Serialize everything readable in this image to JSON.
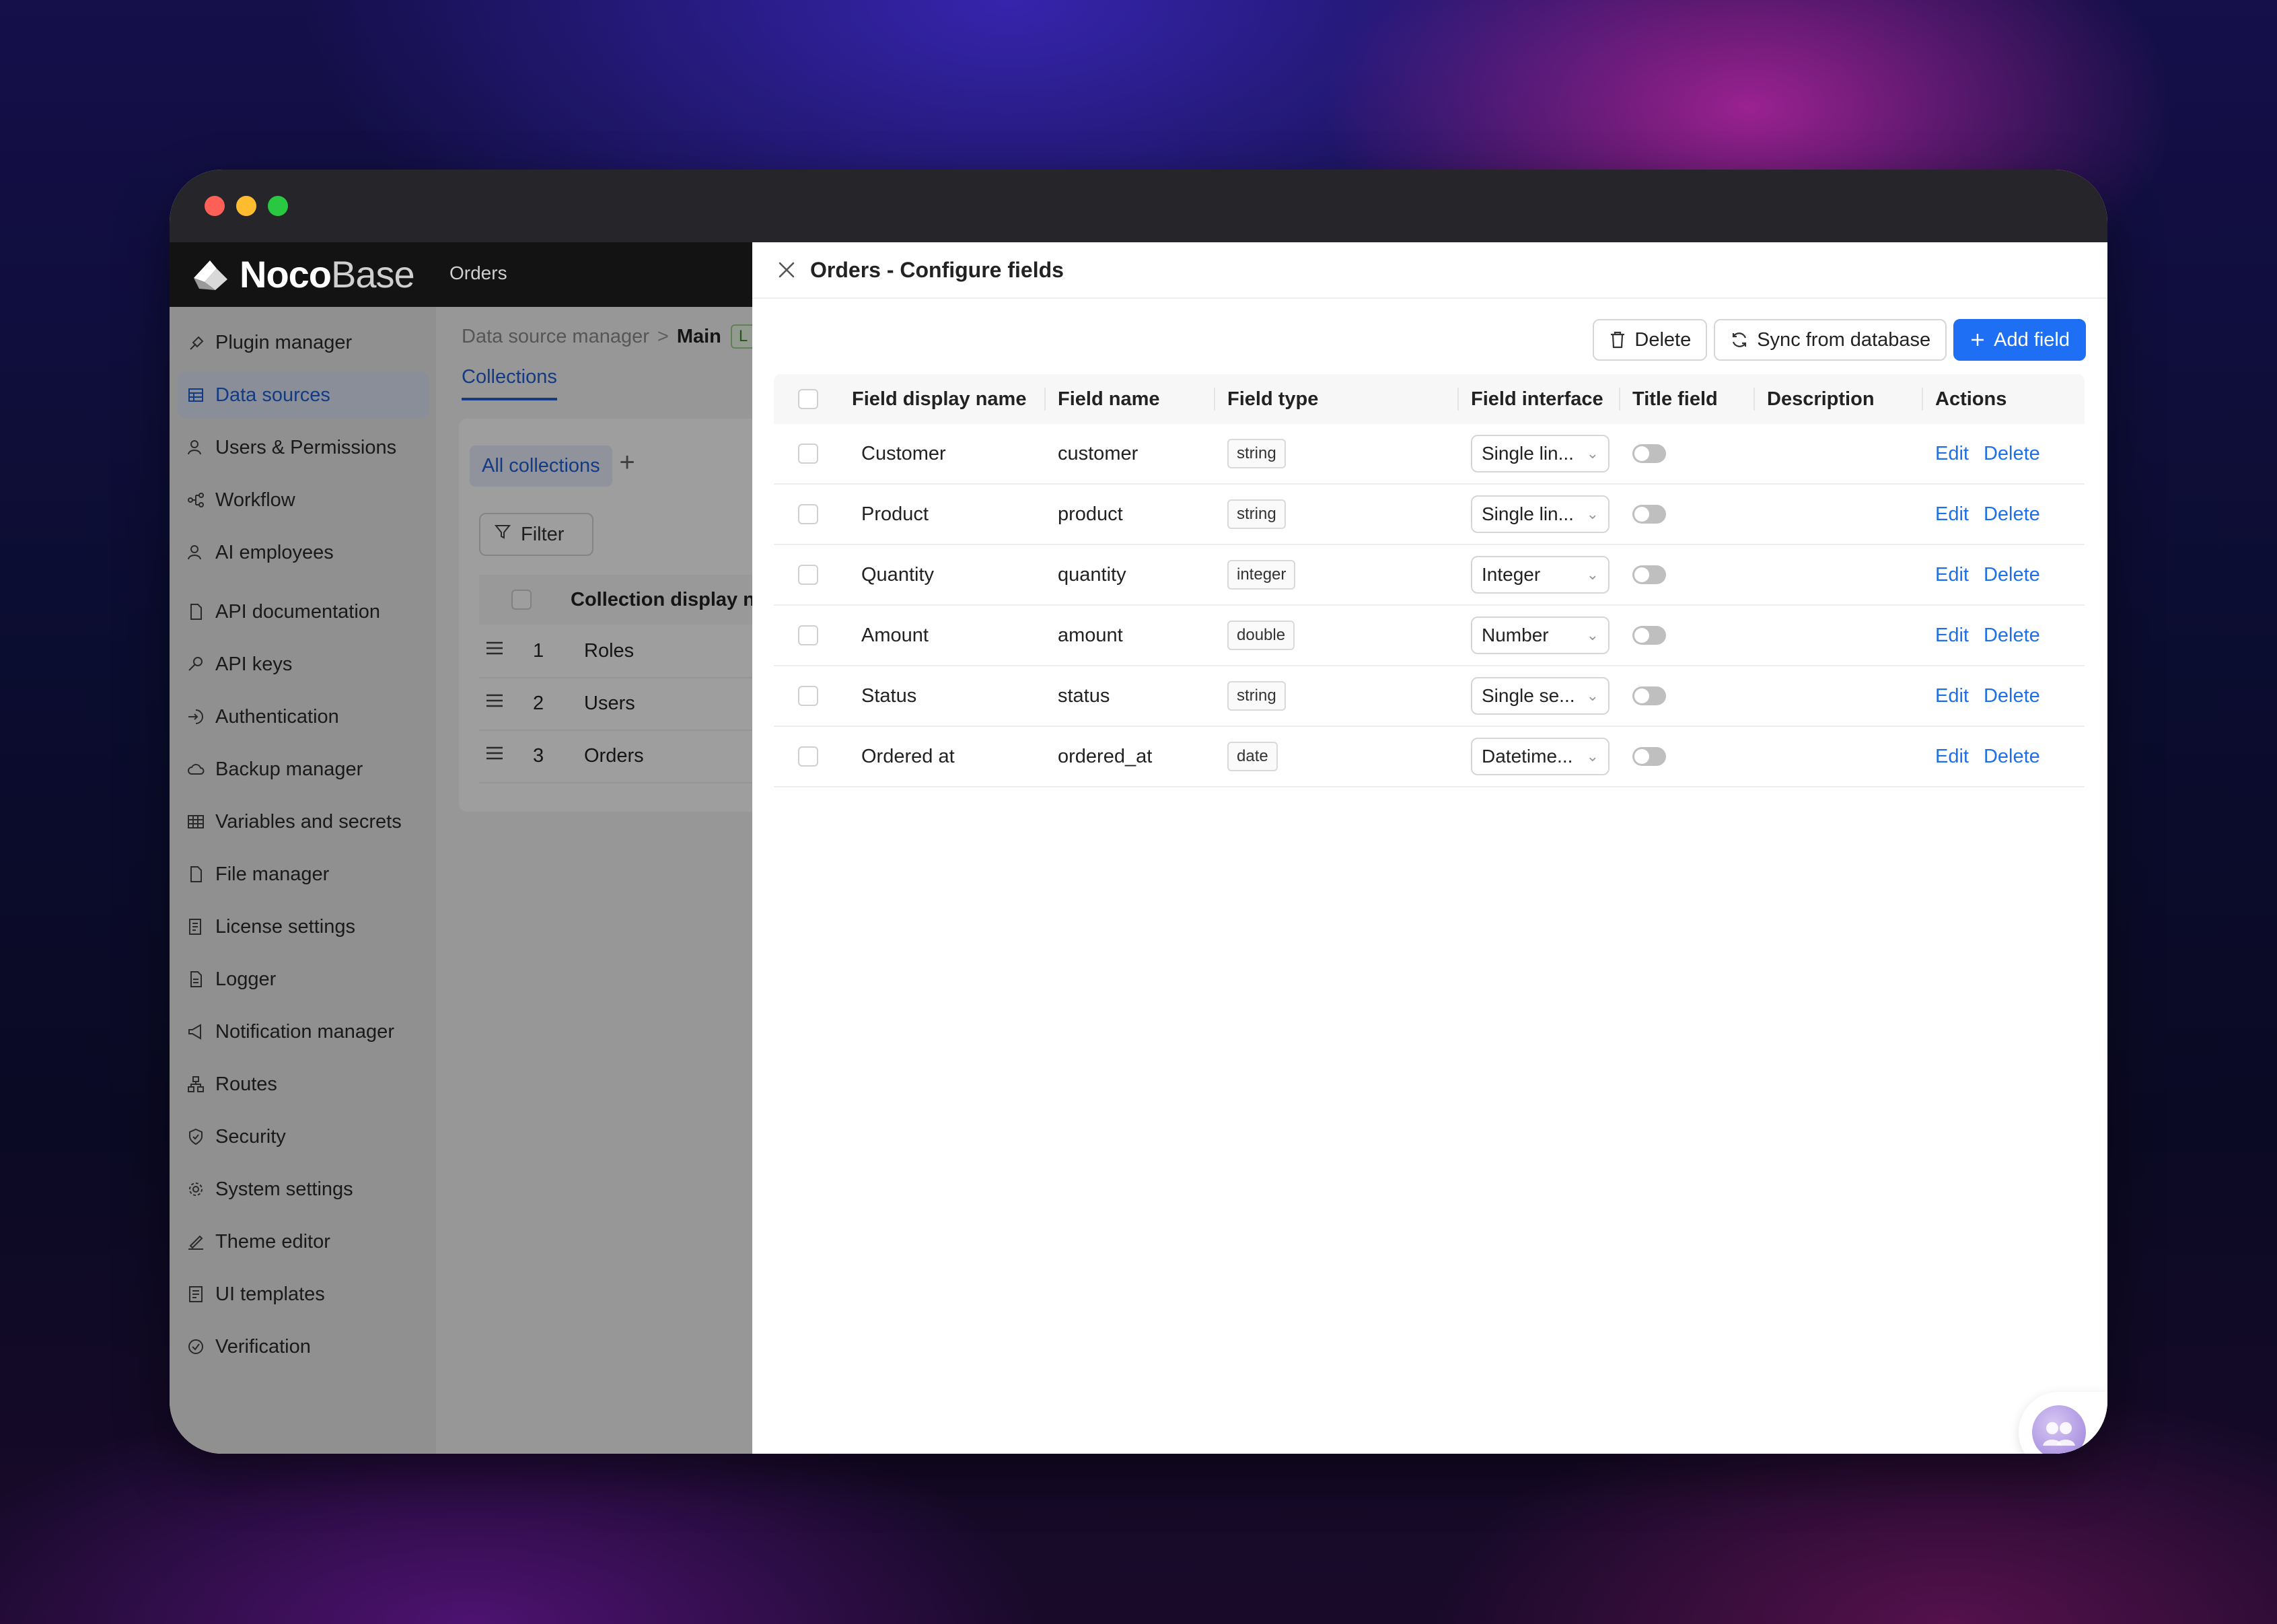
{
  "app": {
    "logo_bold": "Noco",
    "logo_light": "Base",
    "top_menu_item": "Orders"
  },
  "sidebar": {
    "items": [
      {
        "label": "Plugin manager",
        "icon": "plug-icon"
      },
      {
        "label": "Data sources",
        "icon": "database-icon",
        "active": true
      },
      {
        "label": "Users & Permissions",
        "icon": "users-icon"
      },
      {
        "label": "Workflow",
        "icon": "workflow-icon"
      },
      {
        "label": "AI employees",
        "icon": "ai-employee-icon"
      },
      {
        "label": "API documentation",
        "icon": "document-icon"
      },
      {
        "label": "API keys",
        "icon": "key-icon"
      },
      {
        "label": "Authentication",
        "icon": "login-icon"
      },
      {
        "label": "Backup manager",
        "icon": "cloud-icon"
      },
      {
        "label": "Variables and secrets",
        "icon": "table-icon"
      },
      {
        "label": "File manager",
        "icon": "file-icon"
      },
      {
        "label": "License settings",
        "icon": "license-icon"
      },
      {
        "label": "Logger",
        "icon": "log-icon"
      },
      {
        "label": "Notification manager",
        "icon": "megaphone-icon"
      },
      {
        "label": "Routes",
        "icon": "routes-icon"
      },
      {
        "label": "Security",
        "icon": "shield-icon"
      },
      {
        "label": "System settings",
        "icon": "gear-icon"
      },
      {
        "label": "Theme editor",
        "icon": "brush-icon"
      },
      {
        "label": "UI templates",
        "icon": "template-icon"
      },
      {
        "label": "Verification",
        "icon": "check-circle-icon"
      }
    ]
  },
  "background_page": {
    "breadcrumb": {
      "root": "Data source manager",
      "current": "Main",
      "tag": "L"
    },
    "tab": "Collections",
    "sub_tab": "All collections",
    "add_tab": "+",
    "filter_label": "Filter",
    "column_header": "Collection display n",
    "rows": [
      {
        "num": "1",
        "name": "Roles"
      },
      {
        "num": "2",
        "name": "Users"
      },
      {
        "num": "3",
        "name": "Orders"
      }
    ]
  },
  "drawer": {
    "title": "Orders - Configure fields",
    "buttons": {
      "delete": "Delete",
      "sync": "Sync from database",
      "add": "Add field"
    },
    "columns": [
      "Field display name",
      "Field name",
      "Field type",
      "Field interface",
      "Title field",
      "Description",
      "Actions"
    ],
    "rows": [
      {
        "display": "Customer",
        "name": "customer",
        "type": "string",
        "interface": "Single lin...",
        "title_field": false,
        "edit": "Edit",
        "delete": "Delete"
      },
      {
        "display": "Product",
        "name": "product",
        "type": "string",
        "interface": "Single lin...",
        "title_field": false,
        "edit": "Edit",
        "delete": "Delete"
      },
      {
        "display": "Quantity",
        "name": "quantity",
        "type": "integer",
        "interface": "Integer",
        "title_field": false,
        "edit": "Edit",
        "delete": "Delete"
      },
      {
        "display": "Amount",
        "name": "amount",
        "type": "double",
        "interface": "Number",
        "title_field": false,
        "edit": "Edit",
        "delete": "Delete"
      },
      {
        "display": "Status",
        "name": "status",
        "type": "string",
        "interface": "Single se...",
        "title_field": false,
        "edit": "Edit",
        "delete": "Delete"
      },
      {
        "display": "Ordered at",
        "name": "ordered_at",
        "type": "date",
        "interface": "Datetime...",
        "title_field": false,
        "edit": "Edit",
        "delete": "Delete"
      }
    ]
  },
  "colors": {
    "primary": "#1e6ff3",
    "link": "#1f6fe8",
    "topbar": "#131313"
  }
}
